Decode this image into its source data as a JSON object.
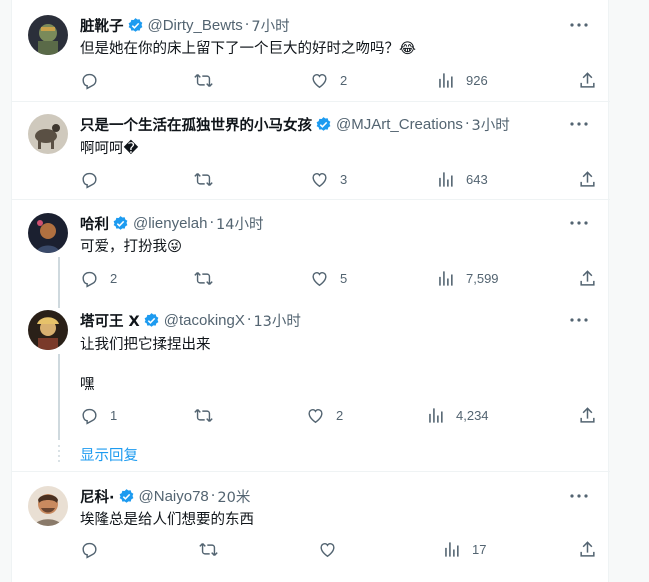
{
  "tweets": [
    {
      "name": "脏靴子",
      "handle": "@Dirty_Bewts",
      "time": "7小时",
      "text": "但是她在你的床上留下了一个巨大的好时之吻吗？",
      "emoji": "😂",
      "replies": "",
      "likes": "2",
      "views": "926",
      "avatar_colors": [
        "#2b2f3a",
        "#7a8a5a"
      ]
    },
    {
      "name": "只是一个生活在孤独世界的小马女孩",
      "handle": "@MJArt_Creations",
      "time": "3小时",
      "text": "啊呵呵�",
      "replies": "",
      "likes": "3",
      "views": "643",
      "avatar_colors": [
        "#cfc9bd",
        "#5a5044"
      ]
    },
    {
      "name": "哈利",
      "handle": "@lienyelah",
      "time": "14小时",
      "text": "可爱，打扮我",
      "emoji": "😜",
      "replies": "2",
      "likes": "5",
      "views": "7,599",
      "avatar_colors": [
        "#1b2030",
        "#b07040"
      ]
    },
    {
      "name": "塔可王 X",
      "handle": "@tacokingX",
      "time": "13小时",
      "text": "让我们把它揉捏出来",
      "text2": "嘿",
      "replies": "1",
      "likes": "2",
      "views": "4,234",
      "avatar_colors": [
        "#2a2018",
        "#d8b070"
      ]
    },
    {
      "name": "尼科·",
      "handle": "@Naiyo78",
      "time": "20米",
      "text": "埃隆总是给人们想要的东西",
      "replies": "",
      "likes": "",
      "views": "17",
      "avatar_colors": [
        "#c98a5f",
        "#4a3020"
      ]
    }
  ],
  "show_replies": "显示回复",
  "colors": {
    "verified": "#1d9bf0",
    "muted": "#536471",
    "link": "#1d9bf0",
    "divider": "#eff3f4",
    "thread_line": "#cfd9de"
  },
  "icons": [
    "reply-icon",
    "retweet-icon",
    "like-icon",
    "views-icon",
    "share-icon",
    "more-icon",
    "verified-icon"
  ]
}
